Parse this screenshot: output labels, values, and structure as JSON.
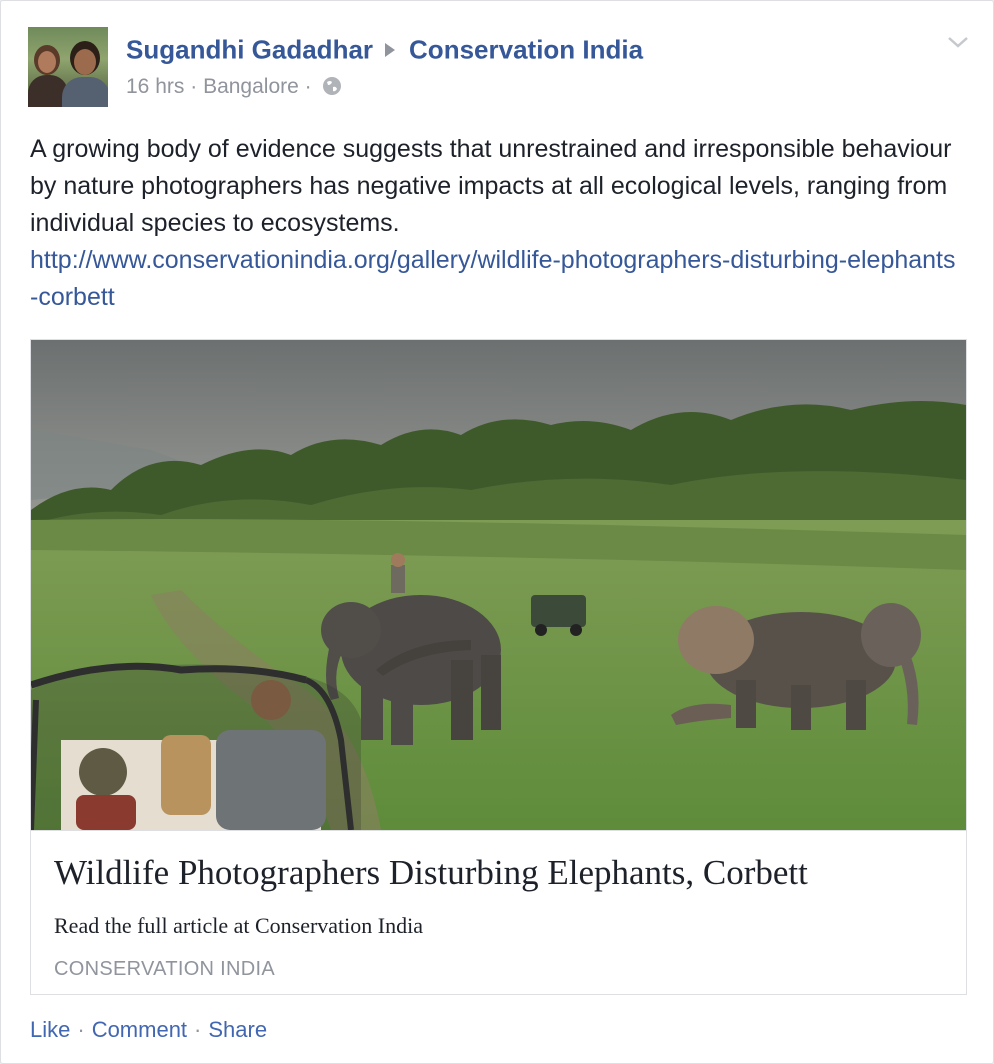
{
  "post": {
    "author": "Sugandhi Gadadhar",
    "target": "Conservation India",
    "time": "16 hrs",
    "location": "Bangalore",
    "meta_sep": "·",
    "privacy_icon": "globe-icon",
    "menu_icon": "chevron-down-icon",
    "text": "A growing body of evidence suggests that unrestrained and irresponsible behaviour by nature photographers has negative impacts at all ecological levels, ranging from individual species to ecosystems.",
    "link": "http://www.conservationindia.org/gallery/wildlife-photographers-disturbing-elephants-corbett"
  },
  "attachment": {
    "title": "Wildlife Photographers Disturbing Elephants, Corbett",
    "description": "Read the full article at Conservation India",
    "source": "CONSERVATION INDIA"
  },
  "actions": {
    "like": "Like",
    "comment": "Comment",
    "share": "Share",
    "sep": "·"
  },
  "colors": {
    "link_blue": "#365899",
    "action_blue": "#4267b2",
    "meta_gray": "#90949c",
    "text": "#1d2129"
  }
}
